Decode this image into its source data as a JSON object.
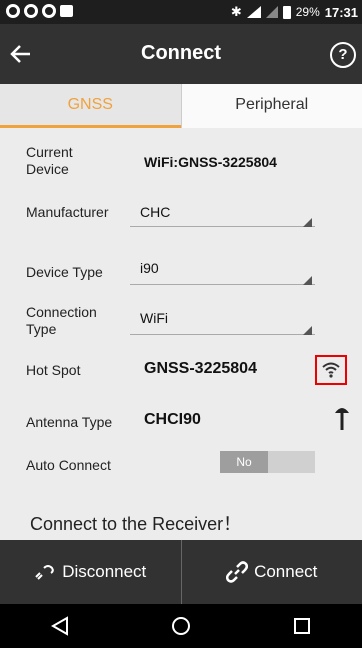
{
  "status": {
    "battery_percent": "29%",
    "time": "17:31"
  },
  "header": {
    "title": "Connect",
    "back_icon": "arrow-left",
    "help_label": "?"
  },
  "tabs": [
    {
      "label": "GNSS",
      "active": true
    },
    {
      "label": "Peripheral",
      "active": false
    }
  ],
  "fields": {
    "current_device_label": "Current\nDevice",
    "current_device_value": "WiFi:GNSS-3225804",
    "manufacturer_label": "Manufacturer",
    "manufacturer_value": "CHC",
    "device_type_label": "Device Type",
    "device_type_value": "i90",
    "connection_type_label": "Connection\nType",
    "connection_type_value": "WiFi",
    "hot_spot_label": "Hot Spot",
    "hot_spot_value": "GNSS-3225804",
    "antenna_type_label": "Antenna Type",
    "antenna_type_value": "CHCI90",
    "auto_connect_label": "Auto Connect",
    "auto_connect_value": "No"
  },
  "message": "Connect to the Receiver！",
  "bottom": {
    "disconnect_label": "Disconnect",
    "connect_label": "Connect"
  },
  "colors": {
    "accent": "#f0a23c",
    "highlight": "#e00000",
    "bar": "#323232"
  }
}
